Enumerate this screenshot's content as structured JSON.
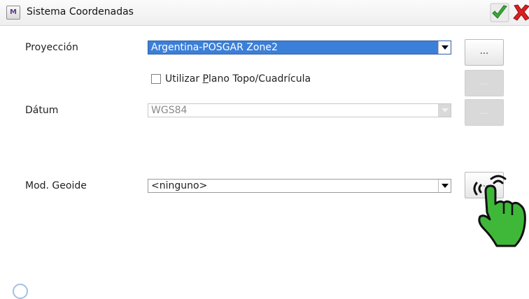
{
  "window": {
    "icon_letter": "M",
    "title": "Sistema Coordenadas"
  },
  "form": {
    "projection": {
      "label": "Proyección",
      "value": "Argentina-POSGAR Zone2",
      "button": "..."
    },
    "use_plane": {
      "label_prefix": "Utilizar ",
      "label_underlined": "P",
      "label_suffix": "lano Topo/Cuadrícula",
      "checked": false,
      "button": "..."
    },
    "datum": {
      "label": "Dátum",
      "value": "WGS84",
      "button": "..."
    },
    "geoid": {
      "label": "Mod. Geoide",
      "value": "<ninguno>",
      "button": "..."
    }
  },
  "colors": {
    "selection": "#3c7fd8",
    "ok_green": "#3aa83a",
    "cancel_red": "#d82020",
    "hand_green": "#3fb83a"
  }
}
